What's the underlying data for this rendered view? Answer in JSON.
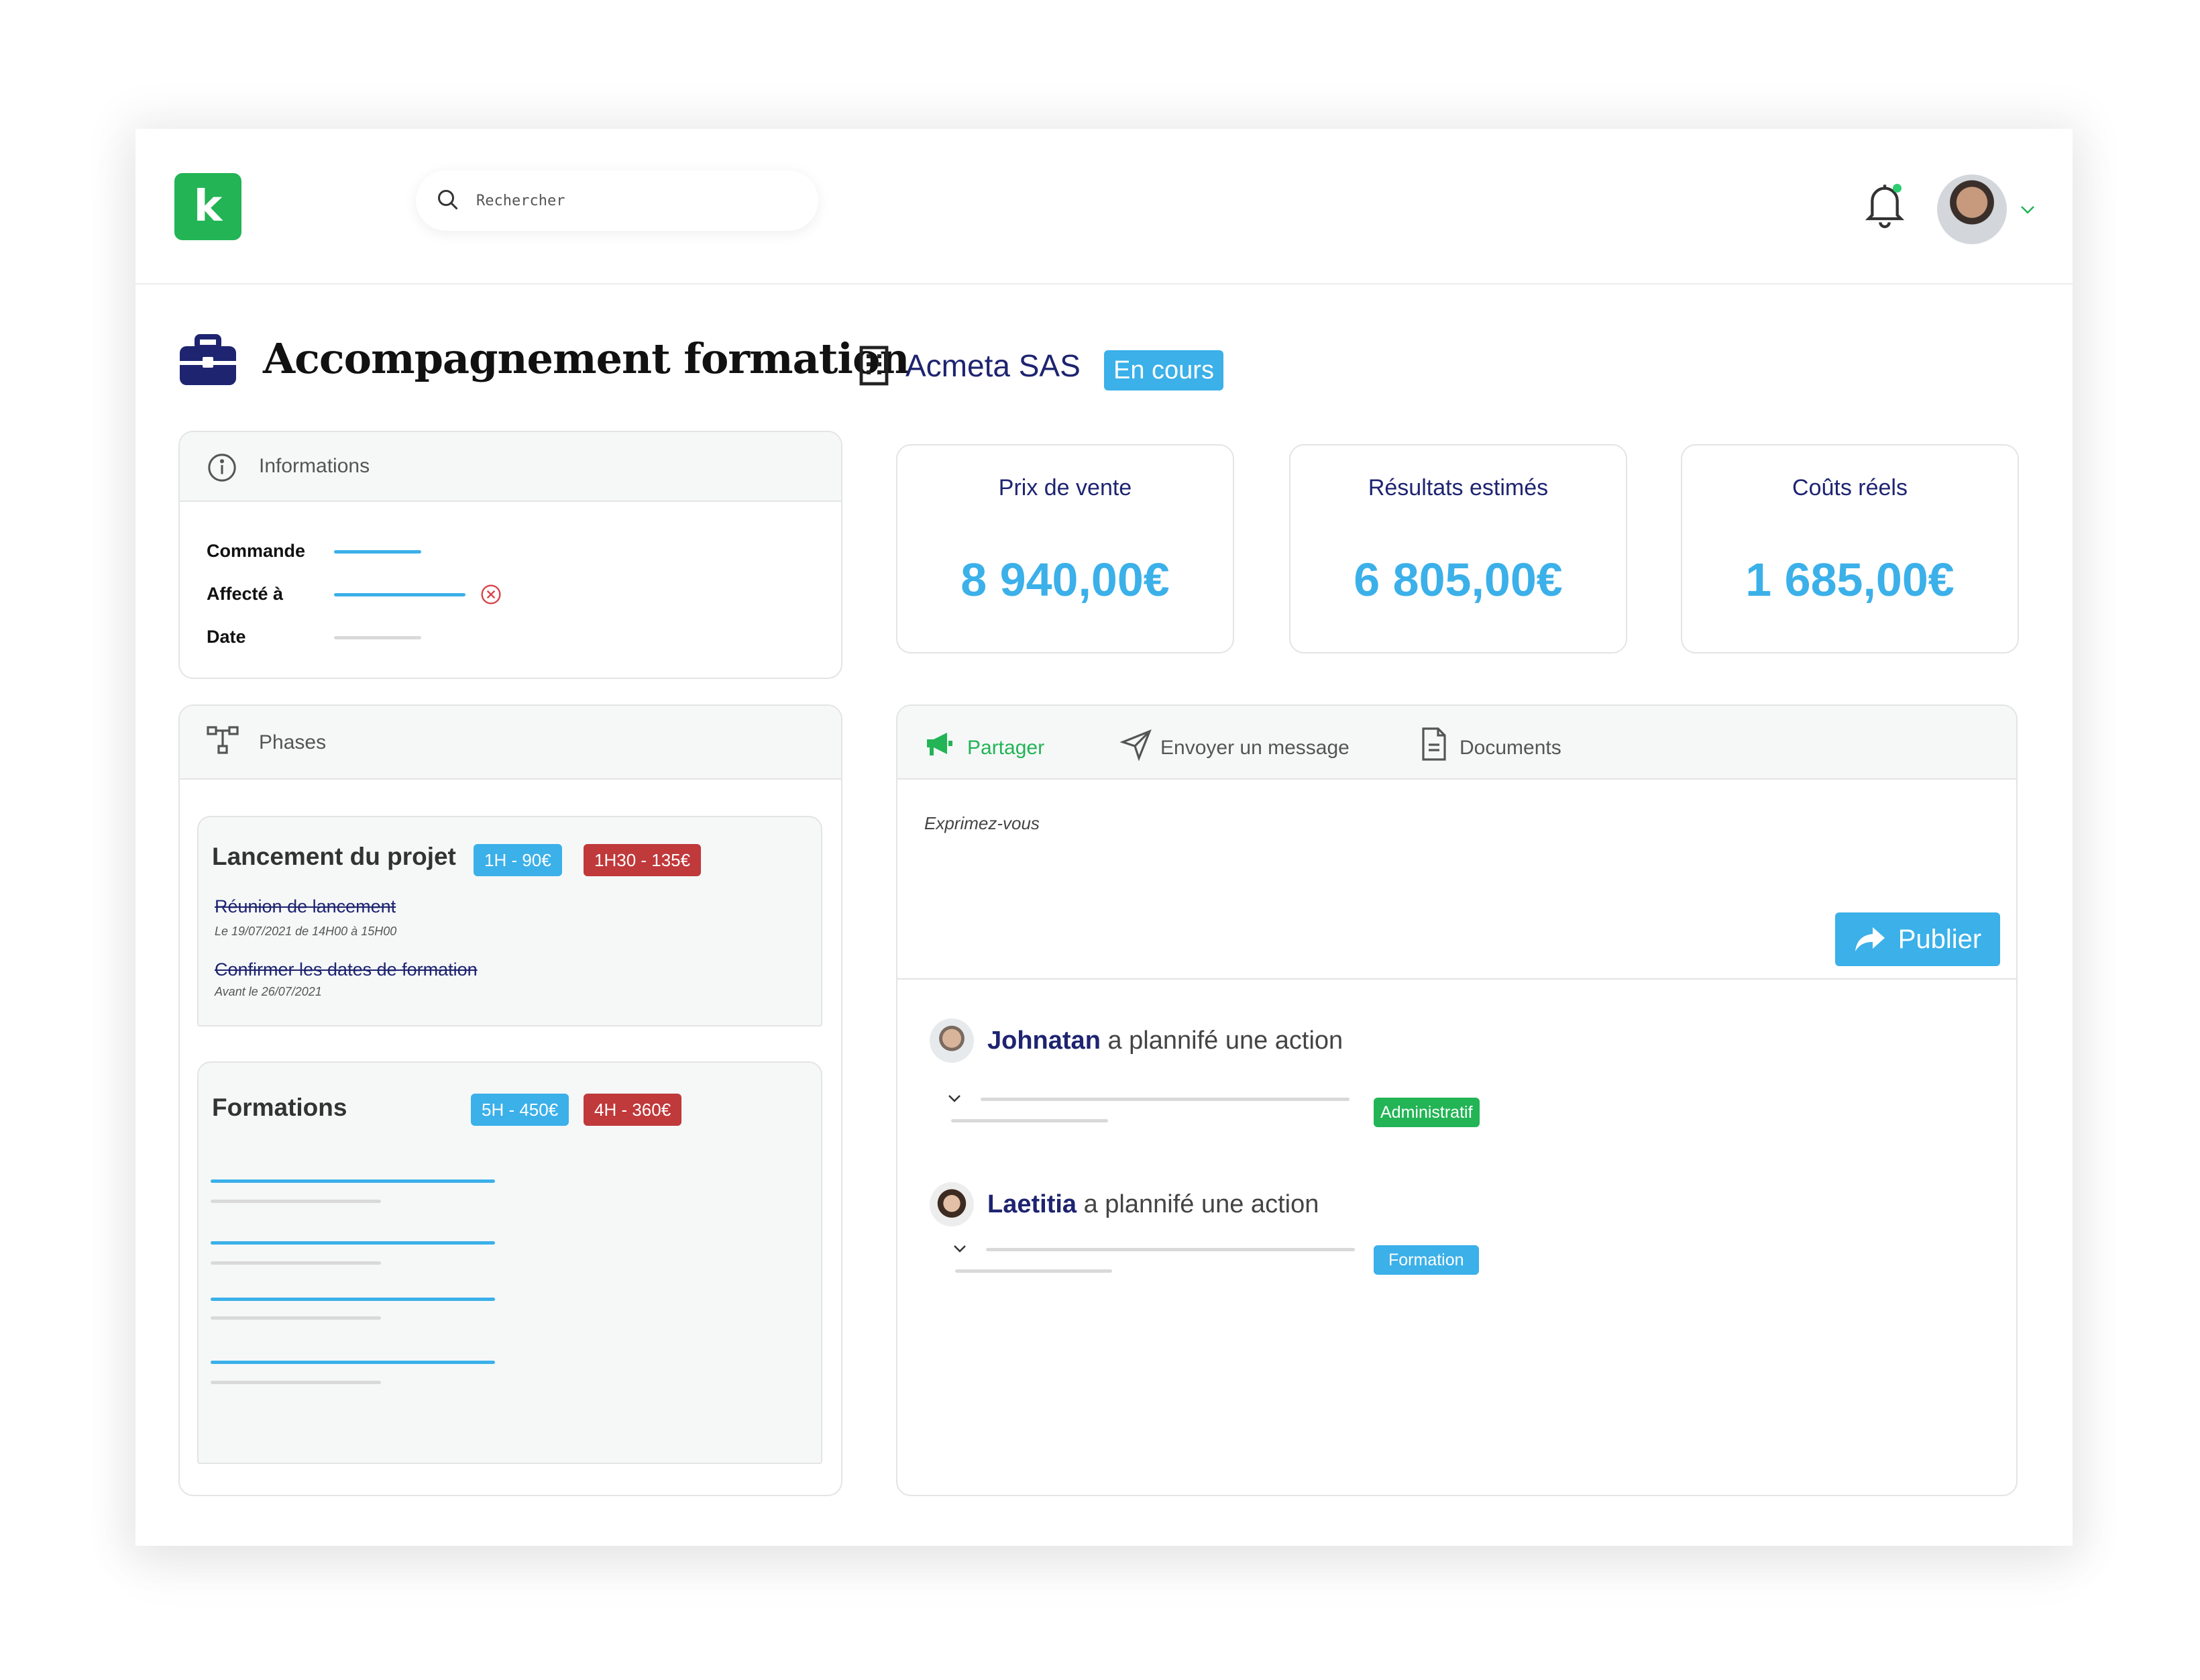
{
  "header": {
    "logo_letter": "k",
    "search_placeholder": "Rechercher",
    "icons": [
      "search-icon",
      "bell-icon",
      "chevron-down-icon"
    ]
  },
  "page": {
    "title": "Accompagnement formation",
    "company": "Acmeta SAS",
    "status": "En cours"
  },
  "informations": {
    "heading": "Informations",
    "fields": [
      "Commande",
      "Affecté à",
      "Date"
    ]
  },
  "stats": [
    {
      "label": "Prix de vente",
      "value": "8 940,00€"
    },
    {
      "label": "Résultats estimés",
      "value": "6 805,00€"
    },
    {
      "label": "Coûts réels",
      "value": "1 685,00€"
    }
  ],
  "phases": {
    "heading": "Phases",
    "launch": {
      "title": "Lancement du projet",
      "tag_planned": "1H - 90€",
      "tag_actual": "1H30 - 135€",
      "tasks": [
        {
          "label": "Réunion de lancement",
          "sub": "Le 19/07/2021 de 14H00 à 15H00"
        },
        {
          "label": "Confirmer les dates de formation",
          "sub": "Avant le 26/07/2021"
        }
      ]
    },
    "formations": {
      "title": "Formations",
      "tag_planned": "5H - 450€",
      "tag_actual": "4H - 360€"
    }
  },
  "feed": {
    "tabs": [
      "Partager",
      "Envoyer un message",
      "Documents"
    ],
    "compose_placeholder": "Exprimez-vous",
    "publish_label": "Publier",
    "items": [
      {
        "name": "Johnatan",
        "action": "a plannifé une action",
        "tag": "Administratif"
      },
      {
        "name": "Laetitia",
        "action": "a plannifé une action",
        "tag": "Formation"
      }
    ]
  },
  "colors": {
    "brand_green": "#22b455",
    "accent_blue": "#3bb0e9",
    "navy": "#1e2470",
    "danger_red": "#c0393b"
  }
}
